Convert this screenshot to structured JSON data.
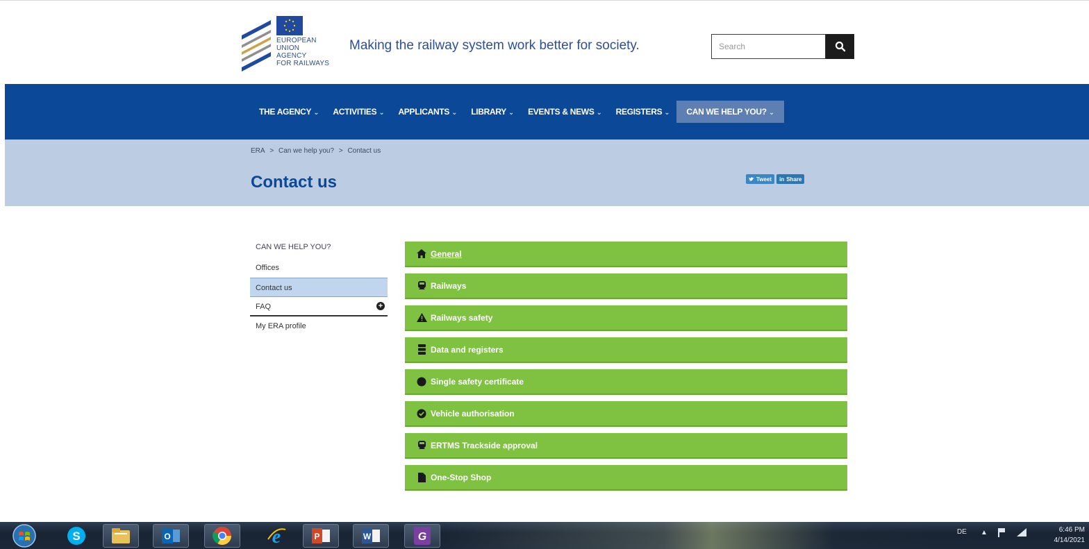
{
  "header": {
    "logo_lines": [
      "EUROPEAN",
      "UNION",
      "AGENCY",
      "FOR RAILWAYS"
    ],
    "tagline": "Making the railway system work better for society.",
    "search_placeholder": "Search"
  },
  "nav": {
    "items": [
      {
        "label": "THE AGENCY"
      },
      {
        "label": "ACTIVITIES"
      },
      {
        "label": "APPLICANTS"
      },
      {
        "label": "LIBRARY"
      },
      {
        "label": "EVENTS & NEWS"
      },
      {
        "label": "REGISTERS"
      },
      {
        "label": "CAN WE HELP YOU?"
      }
    ],
    "active_index": 6
  },
  "breadcrumb": [
    "ERA",
    ">",
    "Can we help you?",
    ">",
    "Contact us"
  ],
  "page_title": "Contact us",
  "share": {
    "tweet_label": "Tweet",
    "linkedin_label": "Share"
  },
  "sidebar": {
    "heading": "CAN WE HELP YOU?",
    "items": [
      {
        "label": "Offices"
      },
      {
        "label": "Contact us"
      },
      {
        "label": "FAQ"
      },
      {
        "label": "My ERA profile"
      }
    ]
  },
  "accordion": {
    "items": [
      {
        "label": "General",
        "icon": "home-icon"
      },
      {
        "label": "Railways",
        "icon": "train-icon"
      },
      {
        "label": "Railways safety",
        "icon": "warning-icon"
      },
      {
        "label": "Data and registers",
        "icon": "database-icon"
      },
      {
        "label": "Single safety certificate",
        "icon": "circle-icon"
      },
      {
        "label": "Vehicle authorisation",
        "icon": "check-circle-icon"
      },
      {
        "label": "ERTMS Trackside approval",
        "icon": "train-icon"
      },
      {
        "label": "One-Stop Shop",
        "icon": "file-icon"
      }
    ],
    "color": "#7fc140"
  },
  "taskbar": {
    "apps": [
      "skype-icon",
      "file-explorer-icon",
      "outlook-icon",
      "chrome-icon",
      "internet-explorer-icon",
      "powerpoint-icon",
      "word-icon",
      "pdf-app-icon"
    ],
    "language": "DE",
    "time": "6:46 PM",
    "date": "4/14/2021"
  },
  "colors": {
    "brand_blue": "#0b4898",
    "band": "#bccce3",
    "accordion_green": "#7fc140"
  }
}
